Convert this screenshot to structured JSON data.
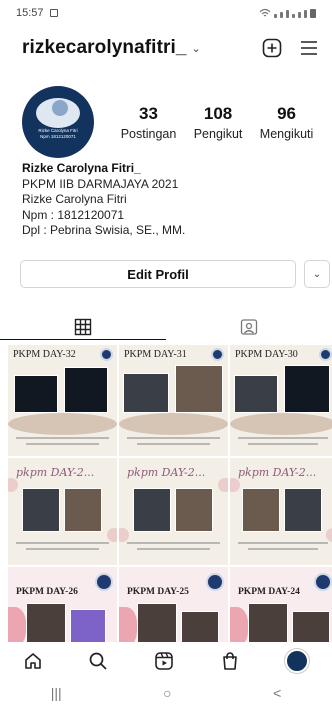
{
  "status_bar": {
    "time": "15:57"
  },
  "header": {
    "username": "rizkecarolynafitri_",
    "chevron": "⌄",
    "icons": [
      "add-post-icon",
      "menu-icon"
    ]
  },
  "profile": {
    "avatar_caption_1": "Rizke Carolyna Fitri",
    "avatar_caption_2": "Npm 1812120071",
    "stats": [
      {
        "value": "33",
        "label": "Postingan"
      },
      {
        "value": "108",
        "label": "Pengikut"
      },
      {
        "value": "96",
        "label": "Mengikuti"
      }
    ]
  },
  "bio": {
    "name": "Rizke Carolyna Fitri_",
    "lines": [
      "PKPM IIB DARMAJAYA 2021",
      "Rizke Carolyna Fitri",
      "Npm : 1812120071",
      "Dpl : Pebrina Swisia, SE., MM."
    ]
  },
  "actions": {
    "edit_label": "Edit Profil",
    "dropdown_icon": "⌄"
  },
  "tabs": [
    {
      "icon": "grid-icon",
      "active": true
    },
    {
      "icon": "tagged-icon",
      "active": false
    }
  ],
  "posts": [
    {
      "title": "PKPM DAY-32"
    },
    {
      "title": "PKPM DAY-31"
    },
    {
      "title": "PKPM DAY-30"
    },
    {
      "title": "pkpm DAY-2..."
    },
    {
      "title": "pkpm DAY-2..."
    },
    {
      "title": "pkpm DAY-2..."
    },
    {
      "title": "PKPM DAY-26"
    },
    {
      "title": "PKPM DAY-25"
    },
    {
      "title": "PKPM DAY-24"
    }
  ],
  "bottom_nav": [
    "home-icon",
    "search-icon",
    "reels-icon",
    "shop-icon",
    "profile-avatar"
  ],
  "system_nav": {
    "recents": "|||",
    "home": "○",
    "back": "<"
  }
}
